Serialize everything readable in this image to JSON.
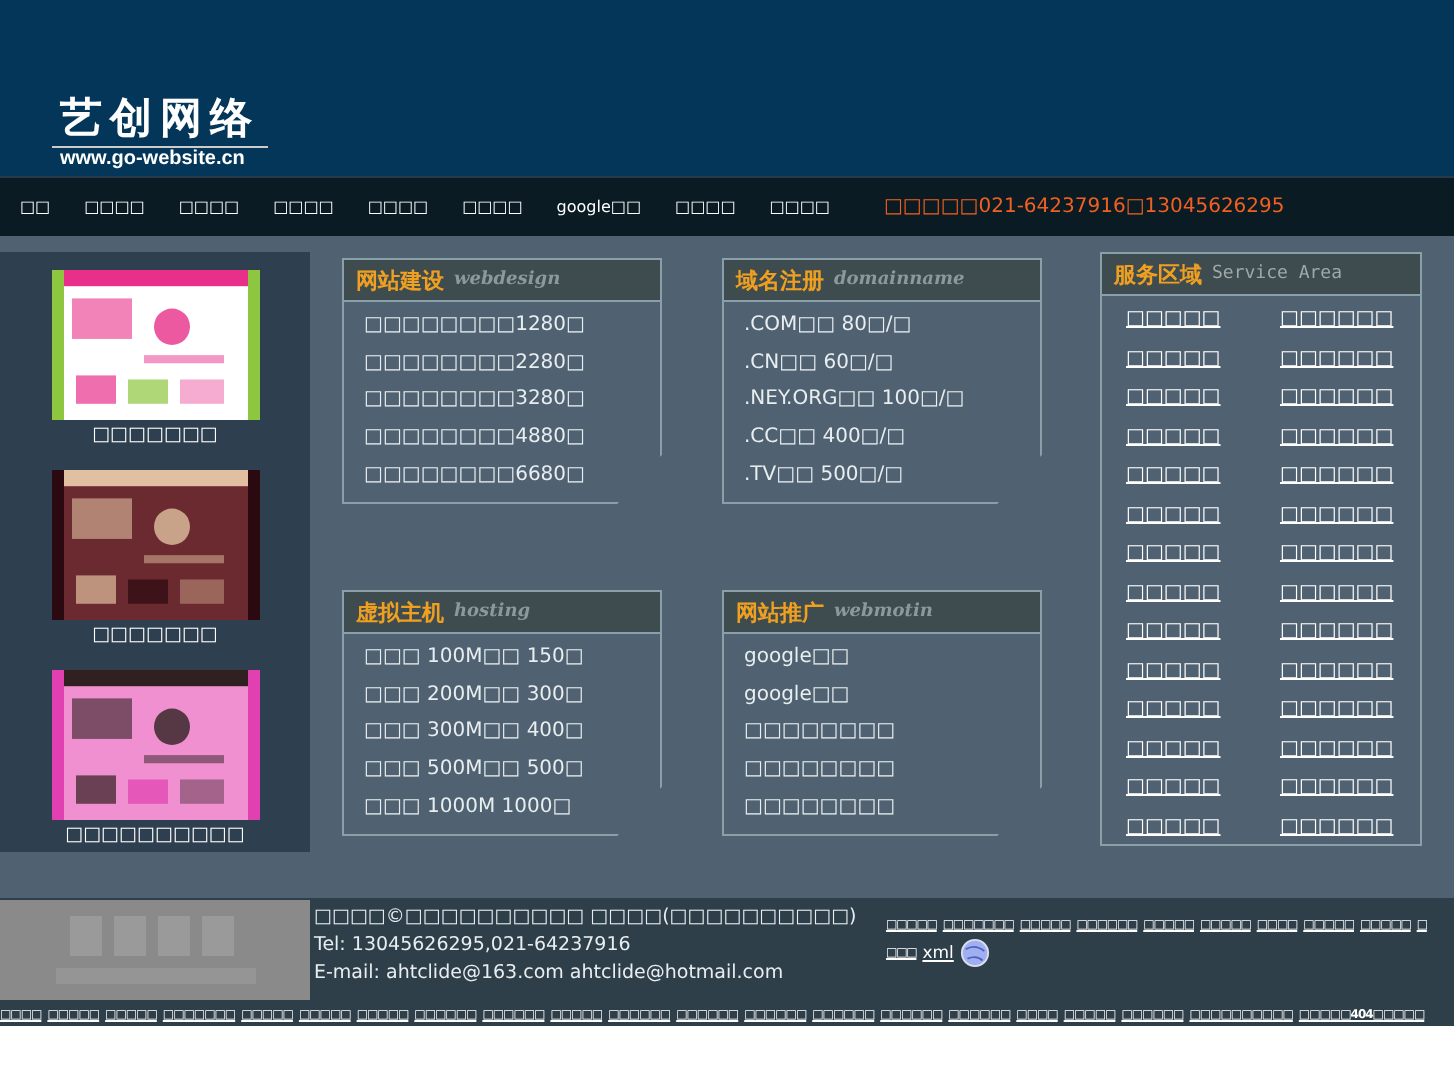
{
  "logo": {
    "name": "艺创网络",
    "url": "www.go-website.cn"
  },
  "nav": {
    "items": [
      "□□",
      "□□□□",
      "□□□□",
      "□□□□",
      "□□□□",
      "□□□□",
      "google□□",
      "□□□□",
      "□□□□"
    ],
    "phone": "□□□□□021-64237916□13045626295"
  },
  "portfolio": [
    {
      "kind": "picture",
      "caption": "□□□□□□□"
    },
    {
      "kind": "picture",
      "caption": "□□□□□□□"
    },
    {
      "kind": "picture",
      "caption": "□□□□□□□□□□"
    }
  ],
  "boxes": [
    {
      "title": "网站建设",
      "subtitle": "webdesign",
      "lines": [
        "□□□□□□□□1280□",
        "□□□□□□□□2280□",
        "□□□□□□□□3280□",
        "□□□□□□□□4880□",
        "□□□□□□□□6680□"
      ]
    },
    {
      "title": "域名注册",
      "subtitle": "domainname",
      "lines": [
        ".COM□□ 80□/□",
        ".CN□□ 60□/□",
        ".NEY.ORG□□ 100□/□",
        ".CC□□ 400□/□",
        ".TV□□ 500□/□"
      ]
    },
    {
      "title": "虚拟主机",
      "subtitle": "hosting",
      "lines": [
        "□□□ 100M□□ 150□",
        "□□□ 200M□□ 300□",
        "□□□ 300M□□ 400□",
        "□□□ 500M□□ 500□",
        "□□□ 1000M   1000□"
      ]
    },
    {
      "title": "网站推广",
      "subtitle": "webmotin",
      "lines": [
        "google□□",
        "google□□",
        "□□□□□□□□",
        "□□□□□□□□",
        "□□□□□□□□"
      ]
    }
  ],
  "service_area": {
    "title": "服务区域",
    "subtitle": "Service Area",
    "links": [
      "□□□□□",
      "□□□□□□",
      "□□□□□",
      "□□□□□□",
      "□□□□□",
      "□□□□□□",
      "□□□□□",
      "□□□□□□",
      "□□□□□",
      "□□□□□□",
      "□□□□□",
      "□□□□□□",
      "□□□□□",
      "□□□□□□",
      "□□□□□",
      "□□□□□□",
      "□□□□□",
      "□□□□□□",
      "□□□□□",
      "□□□□□□",
      "□□□□□",
      "□□□□□□",
      "□□□□□",
      "□□□□□□",
      "□□□□□",
      "□□□□□□",
      "□□□□□",
      "□□□□□□"
    ]
  },
  "footer": {
    "copyright": "□□□□©□□□□□□□□□□ □□□□(□□□□□□□□□□)",
    "tel": "Tel: 13045626295,021-64237916",
    "email": "E-mail: ahtclide@163.com ahtclide@hotmail.com",
    "links": [
      "□□□□□",
      "□□□□□□□",
      "□□□□□",
      "□□□□□□",
      "□□□□□",
      "□□□□□",
      "□□□□",
      "□□□□□",
      "□□□□□",
      "□"
    ],
    "sitemap": "□□□",
    "xml": "xml"
  },
  "bottom_links": [
    "□□□□",
    "□□□□□",
    "□□□□□",
    "□□□□□□□",
    "□□□□□",
    "□□□□□",
    "□□□□□",
    "□□□□□□",
    "□□□□□□",
    "□□□□□",
    "□□□□□□",
    "□□□□□□",
    "□□□□□□",
    "□□□□□□",
    "□□□□□□",
    "□□□□□□",
    "□□□□",
    "□□□□□",
    "□□□□□□",
    "□□□□□□□□□□",
    "□□□□□404□□□□□"
  ]
}
